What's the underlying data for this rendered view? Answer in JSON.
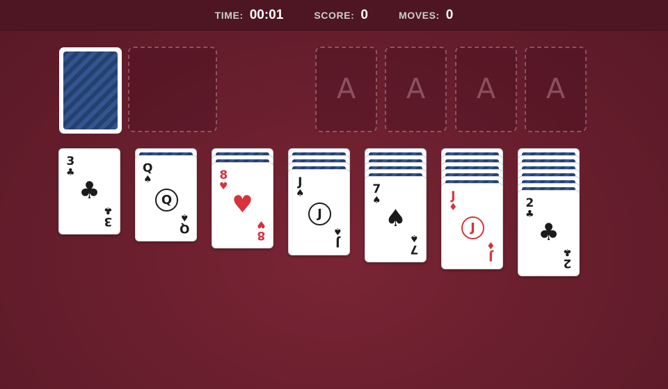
{
  "header": {
    "time_label": "TIME:",
    "time_value": "00:01",
    "score_label": "SCORE:",
    "score_value": "0",
    "moves_label": "MOVES:",
    "moves_value": "0"
  },
  "foundations": [
    {
      "placeholder": "A"
    },
    {
      "placeholder": "A"
    },
    {
      "placeholder": "A"
    },
    {
      "placeholder": "A"
    }
  ],
  "stock": {
    "face_down": true
  },
  "waste": {
    "cards": []
  },
  "tableau": [
    {
      "hidden_count": 0,
      "top": {
        "rank": "3",
        "suit": "♣",
        "color": "black",
        "face": false
      }
    },
    {
      "hidden_count": 1,
      "top": {
        "rank": "Q",
        "suit": "♠",
        "color": "black",
        "face": true
      }
    },
    {
      "hidden_count": 2,
      "top": {
        "rank": "8",
        "suit": "♥",
        "color": "red",
        "face": false
      }
    },
    {
      "hidden_count": 3,
      "top": {
        "rank": "J",
        "suit": "♠",
        "color": "black",
        "face": true
      }
    },
    {
      "hidden_count": 4,
      "top": {
        "rank": "7",
        "suit": "♠",
        "color": "black",
        "face": false
      }
    },
    {
      "hidden_count": 5,
      "top": {
        "rank": "J",
        "suit": "♦",
        "color": "red",
        "face": true
      }
    },
    {
      "hidden_count": 6,
      "top": {
        "rank": "2",
        "suit": "♣",
        "color": "black",
        "face": false
      }
    }
  ],
  "colors": {
    "table": "#6a1f2e",
    "topbar": "#4e1522",
    "card_back": "#24406f",
    "red_suit": "#d8323c",
    "black_suit": "#1b1b1b"
  }
}
